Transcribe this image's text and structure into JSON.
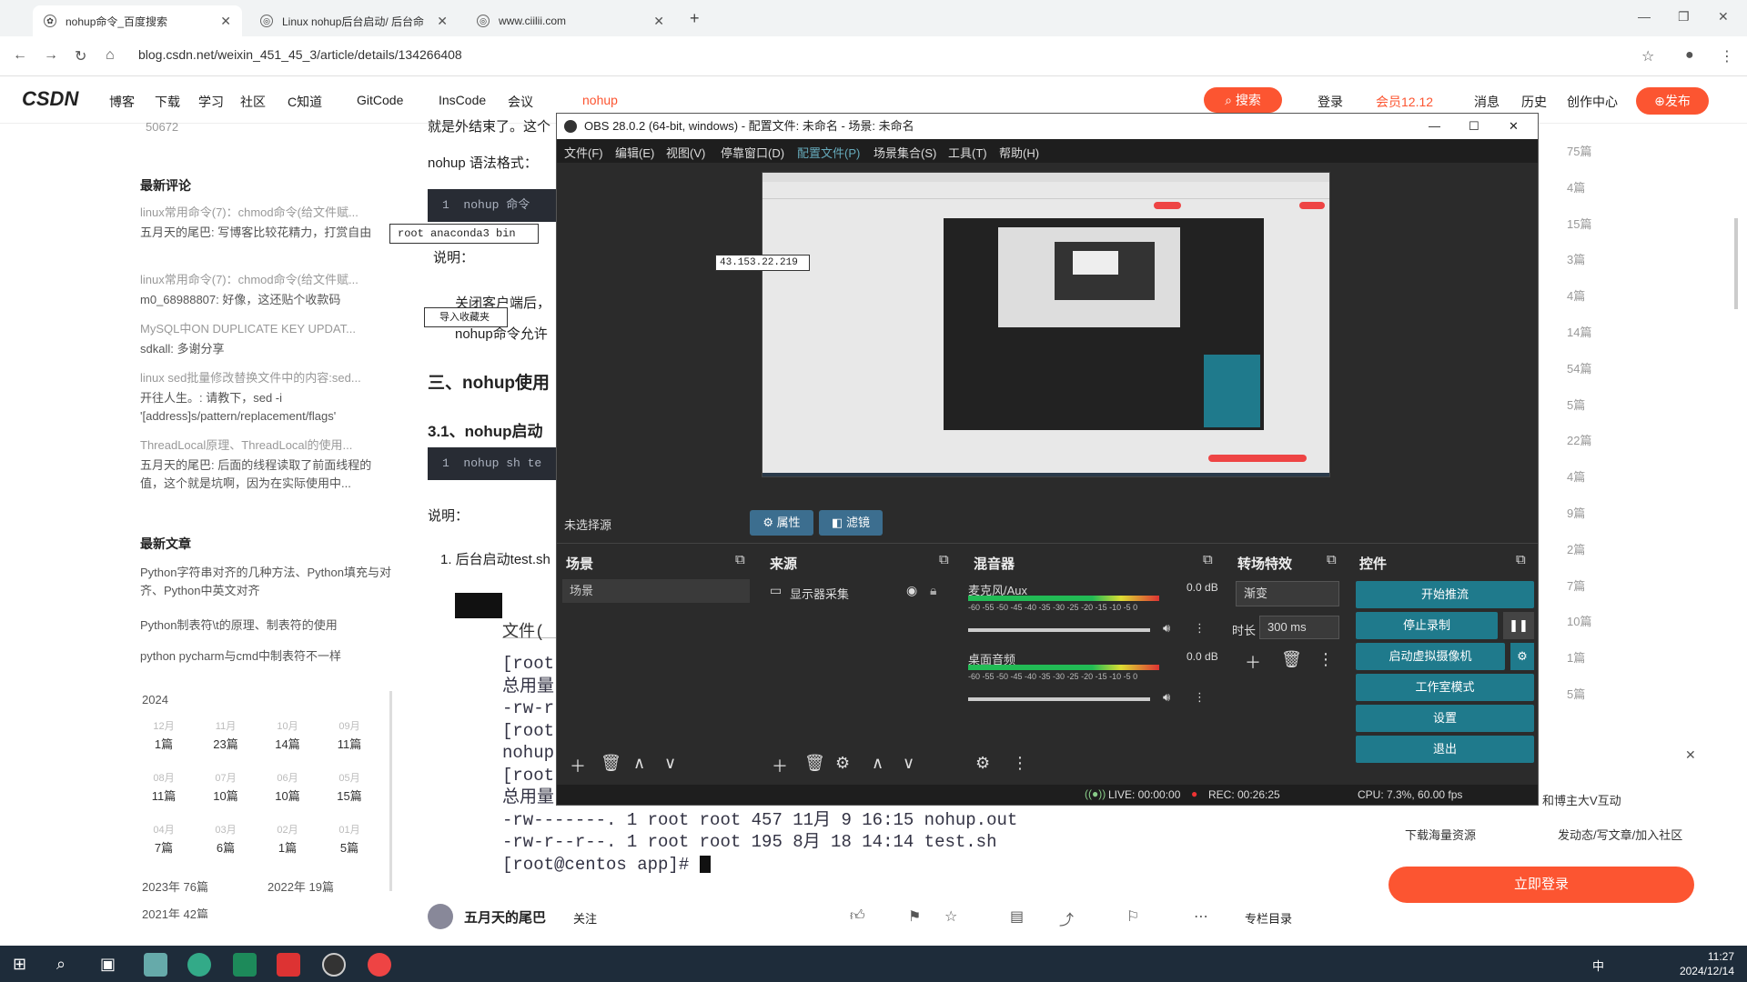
{
  "browser": {
    "tabs": [
      {
        "title": "nohup命令_百度搜索"
      },
      {
        "title": "Linux nohup后台启动/ 后台命"
      },
      {
        "title": "www.ciilii.com"
      }
    ],
    "new_tab": "+",
    "url": "blog.csdn.net/weixin_451_45_3/article/details/134266408"
  },
  "csdn": {
    "logo": "CSDN",
    "nav": [
      "博客",
      "下载",
      "学习",
      "社区",
      "C知道",
      "GitCode",
      "InsCode",
      "会议"
    ],
    "search_text": "nohup",
    "search_button": "搜索",
    "right_nav": [
      "登录",
      "会员12.12",
      "消息",
      "历史",
      "创作中心"
    ],
    "publish_button": "发布"
  },
  "sidebar": {
    "top_count": "50672",
    "recent_comments_title": "最新评论",
    "comments": [
      {
        "title": "linux常用命令(7)：chmod命令(给文件赋...",
        "body": "五月天的尾巴: 写博客比较花精力，打赏自由"
      },
      {
        "title": "linux常用命令(7)：chmod命令(给文件赋...",
        "body": "m0_68988807: 好像，这还贴个收款码"
      },
      {
        "title": "MySQL中ON DUPLICATE KEY UPDAT...",
        "body": "sdkall: 多谢分享"
      },
      {
        "title": "linux sed批量修改替换文件中的内容:sed...",
        "body": "开往人生。: 请教下，sed -i '[address]s/pattern/replacement/flags' filename，当&时!..."
      },
      {
        "title": "ThreadLocal原理、ThreadLocal的使用...",
        "body": "五月天的尾巴: 后面的线程读取了前面线程的值，这个就是坑啊，因为在实际使用中..."
      }
    ],
    "recent_articles_title": "最新文章",
    "articles": [
      "Python字符串对齐的几种方法、Python填充与对齐、Python中英文对齐",
      "Python制表符\\t的原理、制表符的使用",
      "python pycharm与cmd中制表符不一样"
    ],
    "archive_year": "2024",
    "archive": [
      {
        "m": "12月",
        "c": "1篇"
      },
      {
        "m": "11月",
        "c": "23篇"
      },
      {
        "m": "10月",
        "c": "14篇"
      },
      {
        "m": "09月",
        "c": "11篇"
      },
      {
        "m": "08月",
        "c": "11篇"
      },
      {
        "m": "07月",
        "c": "10篇"
      },
      {
        "m": "06月",
        "c": "10篇"
      },
      {
        "m": "05月",
        "c": "15篇"
      },
      {
        "m": "04月",
        "c": "7篇"
      },
      {
        "m": "03月",
        "c": "6篇"
      },
      {
        "m": "02月",
        "c": "1篇"
      },
      {
        "m": "01月",
        "c": "5篇"
      }
    ],
    "year_2023": "2023年 76篇",
    "year_2022": "2022年 19篇",
    "year_2021": "2021年 42篇"
  },
  "article": {
    "line_top": "就是外结束了。这个",
    "syntax_label": "nohup 语法格式：",
    "code1_num": "1",
    "code1": "nohup 命令",
    "explain1": "说明：",
    "bullet1": "关闭客户端后，",
    "bullet2": "nohup命令允许",
    "section3": "三、nohup使用",
    "section31": "3.1、nohup启动",
    "code2_num": "1",
    "code2": "nohup sh te",
    "explain2": "说明：",
    "item1": "1. 后台启动test.sh",
    "tooltip_path": "root anaconda3 bin",
    "tooltip_import": "导入收藏夹",
    "tooltip_ip": "43.153.22.219"
  },
  "terminal": {
    "title": "文件(",
    "lines": [
      "[root",
      "总用量",
      "-rw-r",
      "[root",
      "nohup",
      "[root",
      "总用量",
      "-rw-------. 1  root root 457 11月   9 16:15 nohup.out",
      "-rw-r--r--. 1  root root 195 8月   18 14:14 test.sh",
      "[root@centos app]# "
    ]
  },
  "obs": {
    "title": "OBS 28.0.2 (64-bit, windows) - 配置文件: 未命名 - 场景: 未命名",
    "menu": [
      "文件(F)",
      "编辑(E)",
      "视图(V)",
      "停靠窗口(D)",
      "配置文件(P)",
      "场景集合(S)",
      "工具(T)",
      "帮助(H)"
    ],
    "no_source": "未选择源",
    "props_button": "属性",
    "filters_button": "滤镜",
    "scenes_title": "场景",
    "scene_item": "场景",
    "sources_title": "来源",
    "source_item": "显示器采集",
    "mixer_title": "混音器",
    "mic_label": "麦克风/Aux",
    "mic_db": "0.0 dB",
    "desktop_label": "桌面音频",
    "desktop_db": "0.0 dB",
    "meter_ticks": "-60 -55 -50 -45 -40 -35 -30 -25 -20 -15 -10 -5 0",
    "transitions_title": "转场特效",
    "transition_value": "渐变",
    "duration_label": "时长",
    "duration_value": "300 ms",
    "controls_title": "控件",
    "controls": [
      "开始推流",
      "停止录制",
      "启动虚拟摄像机",
      "工作室模式",
      "设置",
      "退出"
    ],
    "live": "LIVE: 00:00:00",
    "rec": "REC: 00:26:25",
    "cpu": "CPU: 7.3%, 60.00 fps"
  },
  "right": {
    "counts": [
      "75篇",
      "4篇",
      "15篇",
      "3篇",
      "4篇",
      "14篇",
      "54篇",
      "5篇",
      "22篇",
      "4篇",
      "9篇",
      "2篇",
      "7篇",
      "10篇",
      "1篇",
      "5篇"
    ],
    "interact": "和博主大V互动",
    "download": "下载海量资源",
    "community": "发动态/写文章/加入社区",
    "login_button": "立即登录"
  },
  "authorbar": {
    "name": "五月天的尾巴",
    "follow": "关注",
    "column_dir": "专栏目录"
  },
  "taskbar": {
    "time": "11:27",
    "date": "2024/12/14",
    "ime": "中"
  }
}
